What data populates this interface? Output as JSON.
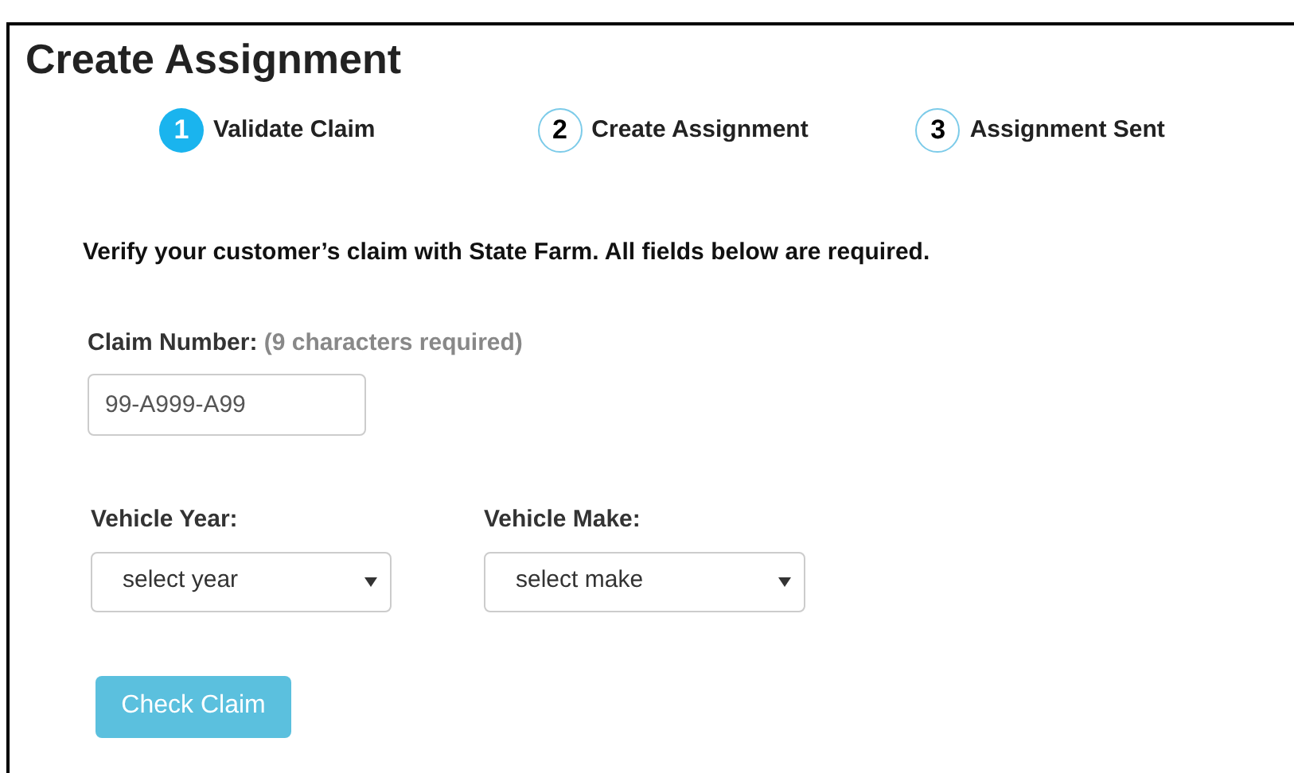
{
  "title": "Create Assignment",
  "steps": [
    {
      "number": "1",
      "label": "Validate Claim",
      "selected": true
    },
    {
      "number": "2",
      "label": "Create Assignment",
      "selected": false
    },
    {
      "number": "3",
      "label": "Assignment Sent",
      "selected": false
    }
  ],
  "intro": "Verify your customer’s claim with State Farm. All fields below are required.",
  "claim_number": {
    "label": "Claim Number:",
    "hint": "(9 characters required)",
    "placeholder": "99-A999-A99"
  },
  "selects": [
    {
      "label": "Vehicle Year:",
      "value": "select year"
    },
    {
      "label": "Vehicle Make:",
      "value": "select make"
    }
  ],
  "button": "Check Claim"
}
